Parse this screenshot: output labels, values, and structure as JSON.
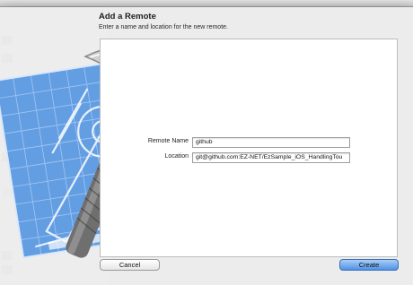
{
  "sheet": {
    "title": "Add a Remote",
    "subtitle": "Enter a name and location for the new remote."
  },
  "form": {
    "remote_name_label": "Remote Name",
    "remote_name_value": "github",
    "location_label": "Location",
    "location_value": "git@github.com:EZ-NET/EzSample_iOS_HandlingTou"
  },
  "buttons": {
    "cancel": "Cancel",
    "create": "Create"
  },
  "icons": {
    "app_icon": "xcode-hammer-blueprint-icon"
  },
  "colors": {
    "primary_button": "#4f93e6",
    "blueprint": "#4a8fe0"
  }
}
